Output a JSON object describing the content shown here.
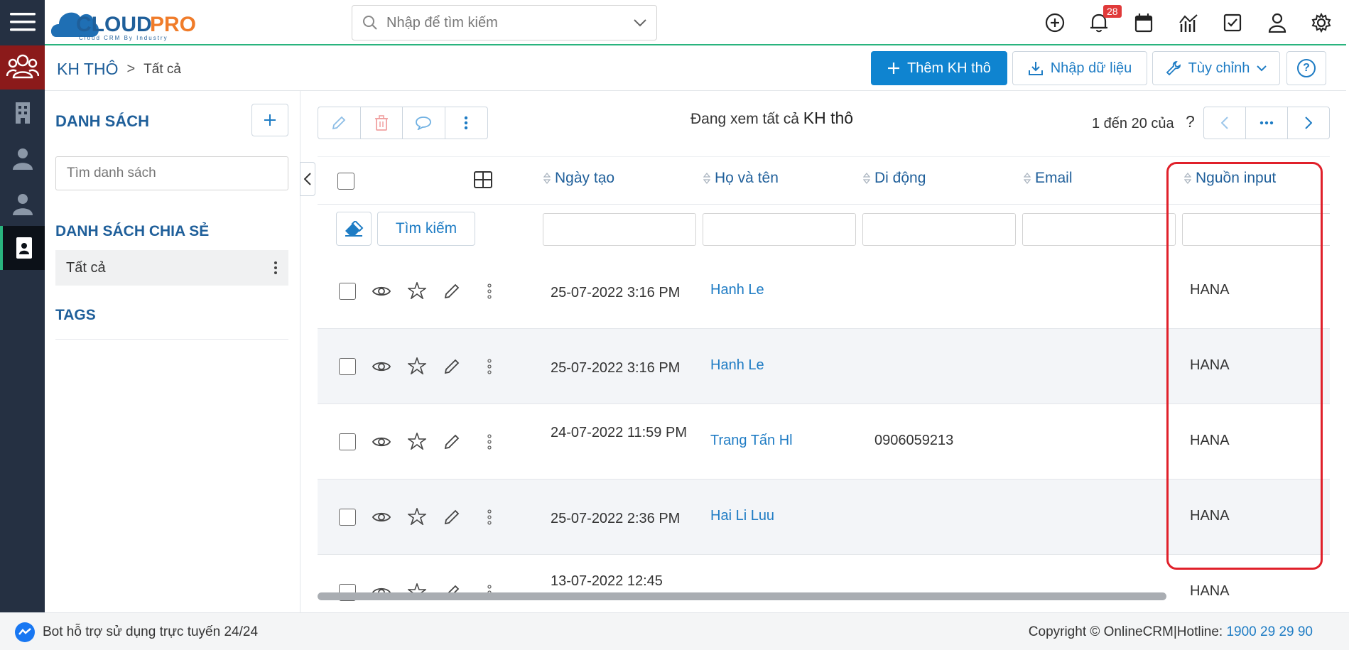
{
  "app": {
    "logo_text": "CLOUDPRO",
    "logo_tagline": "Cloud CRM By Industry"
  },
  "search": {
    "placeholder": "Nhập để tìm kiếm"
  },
  "notifications": {
    "count": "28"
  },
  "breadcrumb": {
    "module": "KH THÔ",
    "separator": ">",
    "view": "Tất cả"
  },
  "toolbar": {
    "add_label": "Thêm KH thô",
    "import_label": "Nhập dữ liệu",
    "customize_label": "Tùy chỉnh",
    "help_label": "?"
  },
  "sidebar": {
    "list_title": "DANH SÁCH",
    "add_label": "+",
    "search_placeholder": "Tìm danh sách",
    "shared_title": "DANH SÁCH CHIA SẺ",
    "shared_items": [
      {
        "label": "Tất cả"
      }
    ],
    "tags_title": "TAGS"
  },
  "list": {
    "viewing_prefix": "Đang xem tất cả",
    "viewing_module": "KH thô",
    "pagination_text": "1 đến 20 của",
    "pagination_unknown": "?",
    "columns": [
      "Ngày tạo",
      "Họ và tên",
      "Di động",
      "Email",
      "Nguồn input"
    ],
    "search_button": "Tìm kiếm",
    "rows": [
      {
        "created": "25-07-2022 3:16 PM",
        "name": "Hanh Le",
        "mobile": "",
        "email": "",
        "source": "HANA"
      },
      {
        "created": "25-07-2022 3:16 PM",
        "name": "Hanh Le",
        "mobile": "",
        "email": "",
        "source": "HANA"
      },
      {
        "created": "24-07-2022 11:59 PM",
        "name": "Trang Tấn Hl",
        "mobile": "0906059213",
        "email": "",
        "source": "HANA"
      },
      {
        "created": "25-07-2022 2:36 PM",
        "name": "Hai Li Luu",
        "mobile": "",
        "email": "",
        "source": "HANA"
      },
      {
        "created": "13-07-2022 12:45",
        "name": "",
        "mobile": "",
        "email": "",
        "source": "HANA"
      }
    ]
  },
  "footer": {
    "bot_text": "Bot hỗ trợ sử dụng trực tuyến 24/24",
    "copyright": "Copyright © OnlineCRM|Hotline:",
    "hotline": "1900 29 29 90"
  },
  "colors": {
    "primary": "#0f84d0",
    "rail": "#253042",
    "rail_active": "#8b1a1a",
    "highlight": "#e0202a"
  }
}
